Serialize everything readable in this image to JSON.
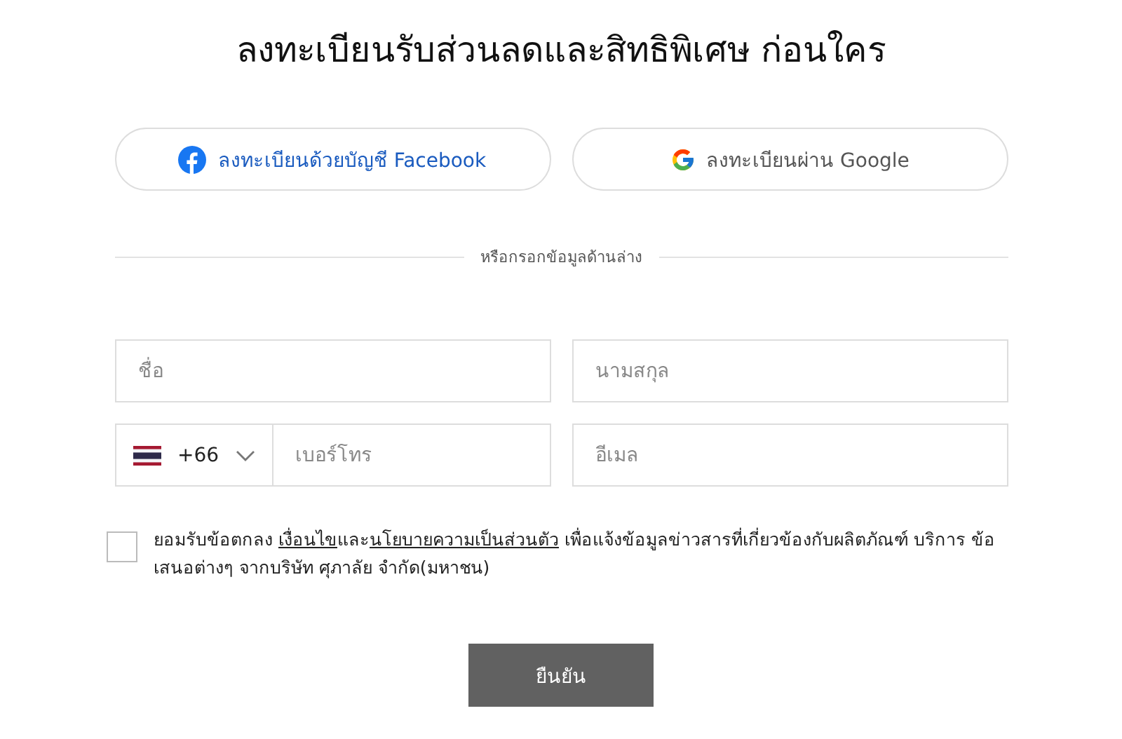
{
  "title": "ลงทะเบียนรับส่วนลดและสิทธิพิเศษ ก่อนใคร",
  "social_buttons": [
    {
      "kind": "facebook",
      "label": "ลงทะเบียนด้วยบัญชี Facebook"
    },
    {
      "kind": "google",
      "label": "ลงทะเบียนผ่าน Google"
    }
  ],
  "divider_text": "หรือกรอกข้อมูลด้านล่าง",
  "fields": {
    "first_name": {
      "placeholder": "ชื่อ"
    },
    "last_name": {
      "placeholder": "นามสกุล"
    },
    "country_code": {
      "value": "+66"
    },
    "phone": {
      "placeholder": "เบอร์โทร"
    },
    "email": {
      "placeholder": "อีเมล"
    }
  },
  "consent": {
    "checked": false,
    "text_before": "ยอมรับข้อตกลง ",
    "terms_link": "เงื่อนไข",
    "text_between": "และ",
    "privacy_link": "นโยบายความเป็นส่วนตัว",
    "text_after": " เพื่อแจ้งข้อมูลข่าวสารที่เกี่ยวข้องกับผลิตภัณฑ์ บริการ ข้อเสนอต่างๆ จากบริษัท ศุภาลัย จำกัด(มหาชน)"
  },
  "submit_button": "ยืนยัน"
}
